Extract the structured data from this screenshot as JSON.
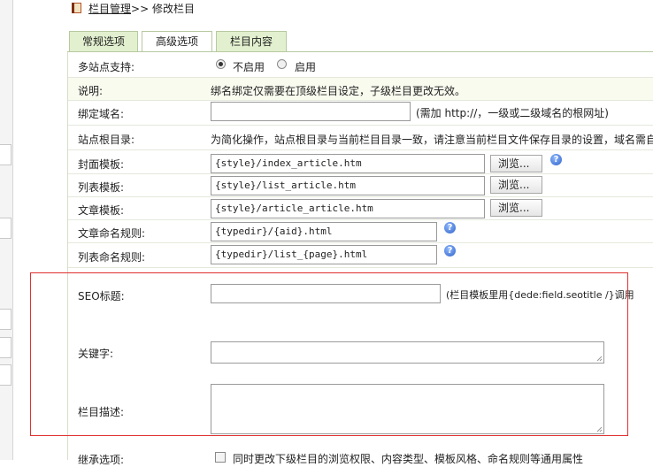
{
  "breadcrumb": {
    "parent": "栏目管理",
    "separator": ">>",
    "current": "修改栏目"
  },
  "tabs": [
    {
      "label": "常规选项",
      "active": false
    },
    {
      "label": "高级选项",
      "active": true
    },
    {
      "label": "栏目内容",
      "active": false
    }
  ],
  "form": {
    "multisite": {
      "label": "多站点支持:",
      "option_off": "不启用",
      "option_on": "启用",
      "selected": "不启用"
    },
    "note": {
      "label": "说明:",
      "text": "绑名绑定仅需要在顶级栏目设定，子级栏目更改无效。"
    },
    "bind_domain": {
      "label": "绑定域名:",
      "value": "",
      "hint": "(需加 http://，一级或二级域名的根网址)"
    },
    "site_root": {
      "label": "站点根目录:",
      "text": "为简化操作，站点根目录与当前栏目目录一致，请注意当前栏目文件保存目录的设置，域名需自"
    },
    "index_template": {
      "label": "封面模板:",
      "value": "{style}/index_article.htm",
      "browse": "浏览..."
    },
    "list_template": {
      "label": "列表模板:",
      "value": "{style}/list_article.htm",
      "browse": "浏览..."
    },
    "article_template": {
      "label": "文章模板:",
      "value": "{style}/article_article.htm",
      "browse": "浏览..."
    },
    "article_rule": {
      "label": "文章命名规则:",
      "value": "{typedir}/{aid}.html"
    },
    "list_rule": {
      "label": "列表命名规则:",
      "value": "{typedir}/list_{page}.html"
    },
    "seo_title": {
      "label": "SEO标题:",
      "value": "",
      "hint": "(栏目模板里用{dede:field.seotitle /}调用"
    },
    "keywords": {
      "label": "关键字:",
      "value": ""
    },
    "description": {
      "label": "栏目描述:",
      "value": ""
    },
    "inherit": {
      "label": "继承选项:",
      "text": "同时更改下级栏目的浏览权限、内容类型、模板风格、命名规则等通用属性"
    }
  },
  "colors": {
    "tab_bg": "#e2f0cf",
    "tab_border": "#b7c9a0",
    "highlight_box": "#e03030",
    "note_row_bg": "#f9fbef",
    "help_icon": "#2f62c8"
  }
}
